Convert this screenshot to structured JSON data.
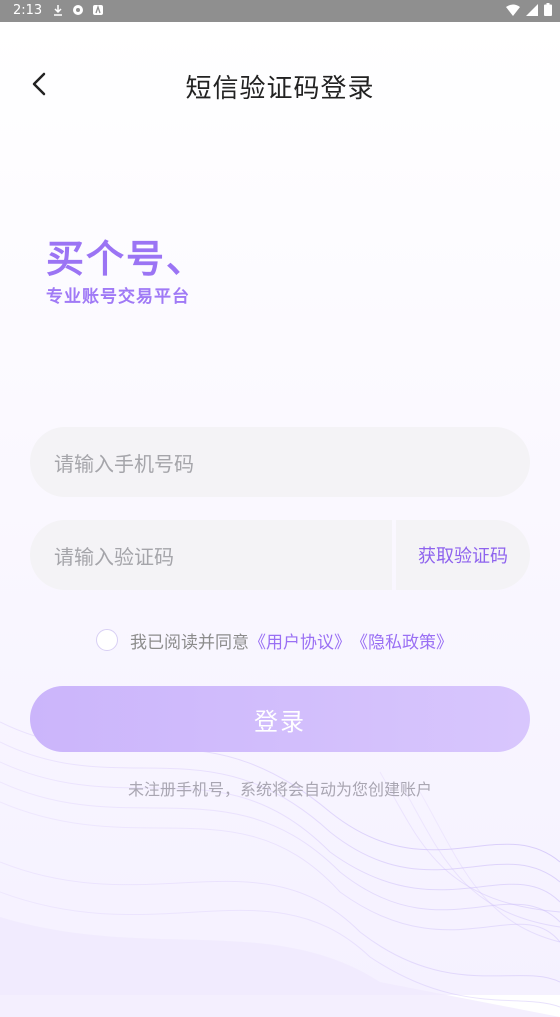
{
  "status": {
    "time": "2:13",
    "icons": [
      "download-icon",
      "shield-icon",
      "a-icon",
      "wifi-icon",
      "signal-icon",
      "battery-icon"
    ]
  },
  "header": {
    "title": "短信验证码登录",
    "back_icon": "chevron-left-icon"
  },
  "logo": {
    "main": "买个号、",
    "sub": "专业账号交易平台"
  },
  "form": {
    "phone_placeholder": "请输入手机号码",
    "code_placeholder": "请输入验证码",
    "get_code_label": "获取验证码"
  },
  "agreement": {
    "prefix": "我已阅读并同意",
    "user_agreement": "《用户协议》",
    "privacy_policy": "《隐私政策》"
  },
  "login_button": "登录",
  "hint": "未注册手机号，系统将会自动为您创建账户",
  "colors": {
    "accent": "#9a70f4",
    "button": "#cbb5fb",
    "field": "#f4f3f6"
  }
}
